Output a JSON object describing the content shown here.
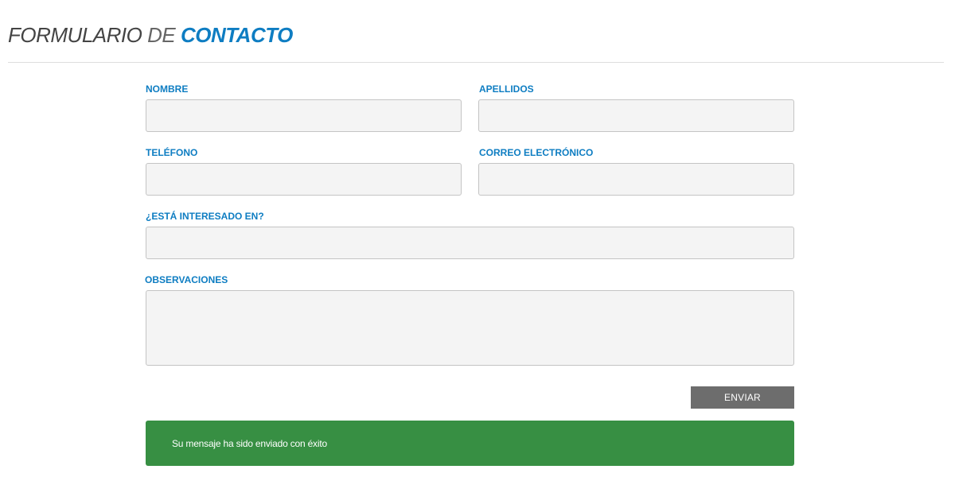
{
  "header": {
    "title_part1": "FORMULARIO",
    "title_part2": "DE",
    "title_part3": "CONTACTO"
  },
  "form": {
    "nombre_label": "NOMBRE",
    "nombre_value": "",
    "apellidos_label": "APELLIDOS",
    "apellidos_value": "",
    "telefono_label": "TELÉFONO",
    "telefono_value": "",
    "correo_label": "CORREO ELECTRÓNICO",
    "correo_value": "",
    "interesado_label": "¿ESTÁ INTERESADO EN?",
    "interesado_value": "",
    "observaciones_label": "OBSERVACIONES",
    "observaciones_value": "",
    "submit_label": "ENVIAR"
  },
  "status": {
    "message": "Su mensaje ha sido enviado con éxito",
    "color": "#378f43"
  },
  "theme": {
    "accent": "#0e7dc2",
    "field_bg": "#f4f4f4",
    "button_bg": "#6d6d6d"
  }
}
